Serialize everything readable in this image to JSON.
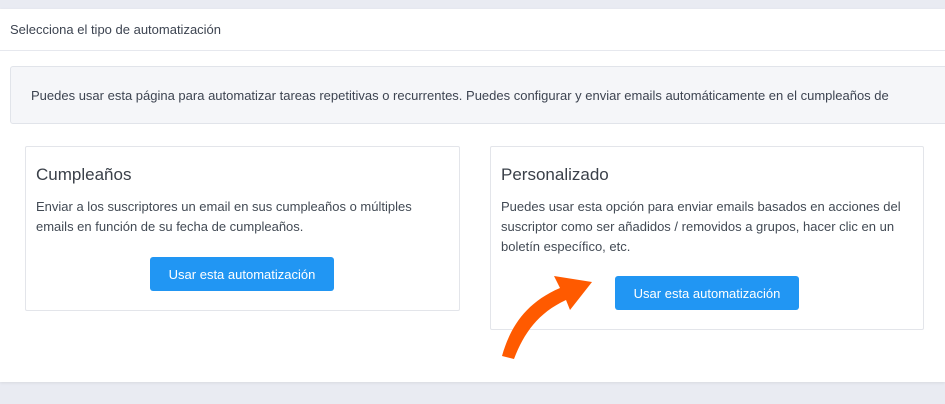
{
  "header": {
    "title": "Selecciona el tipo de automatización"
  },
  "info": {
    "text": "Puedes usar esta página para automatizar tareas repetitivas o recurrentes. Puedes configurar y enviar emails automáticamente en el cumpleaños de"
  },
  "cards": [
    {
      "title": "Cumpleaños",
      "description": "Enviar a los suscriptores un email en sus cumpleaños o múltiples emails en función de su fecha de cumpleaños.",
      "button_label": "Usar esta automatización"
    },
    {
      "title": "Personalizado",
      "description": "Puedes usar esta opción para enviar emails basados en acciones del suscriptor como ser añadidos / removidos a grupos, hacer clic en un boletín específico, etc.",
      "button_label": "Usar esta automatización"
    }
  ],
  "colors": {
    "accent": "#2196f3",
    "arrow": "#ff5a00"
  },
  "annotation": {
    "icon": "orange-arrow-icon"
  }
}
